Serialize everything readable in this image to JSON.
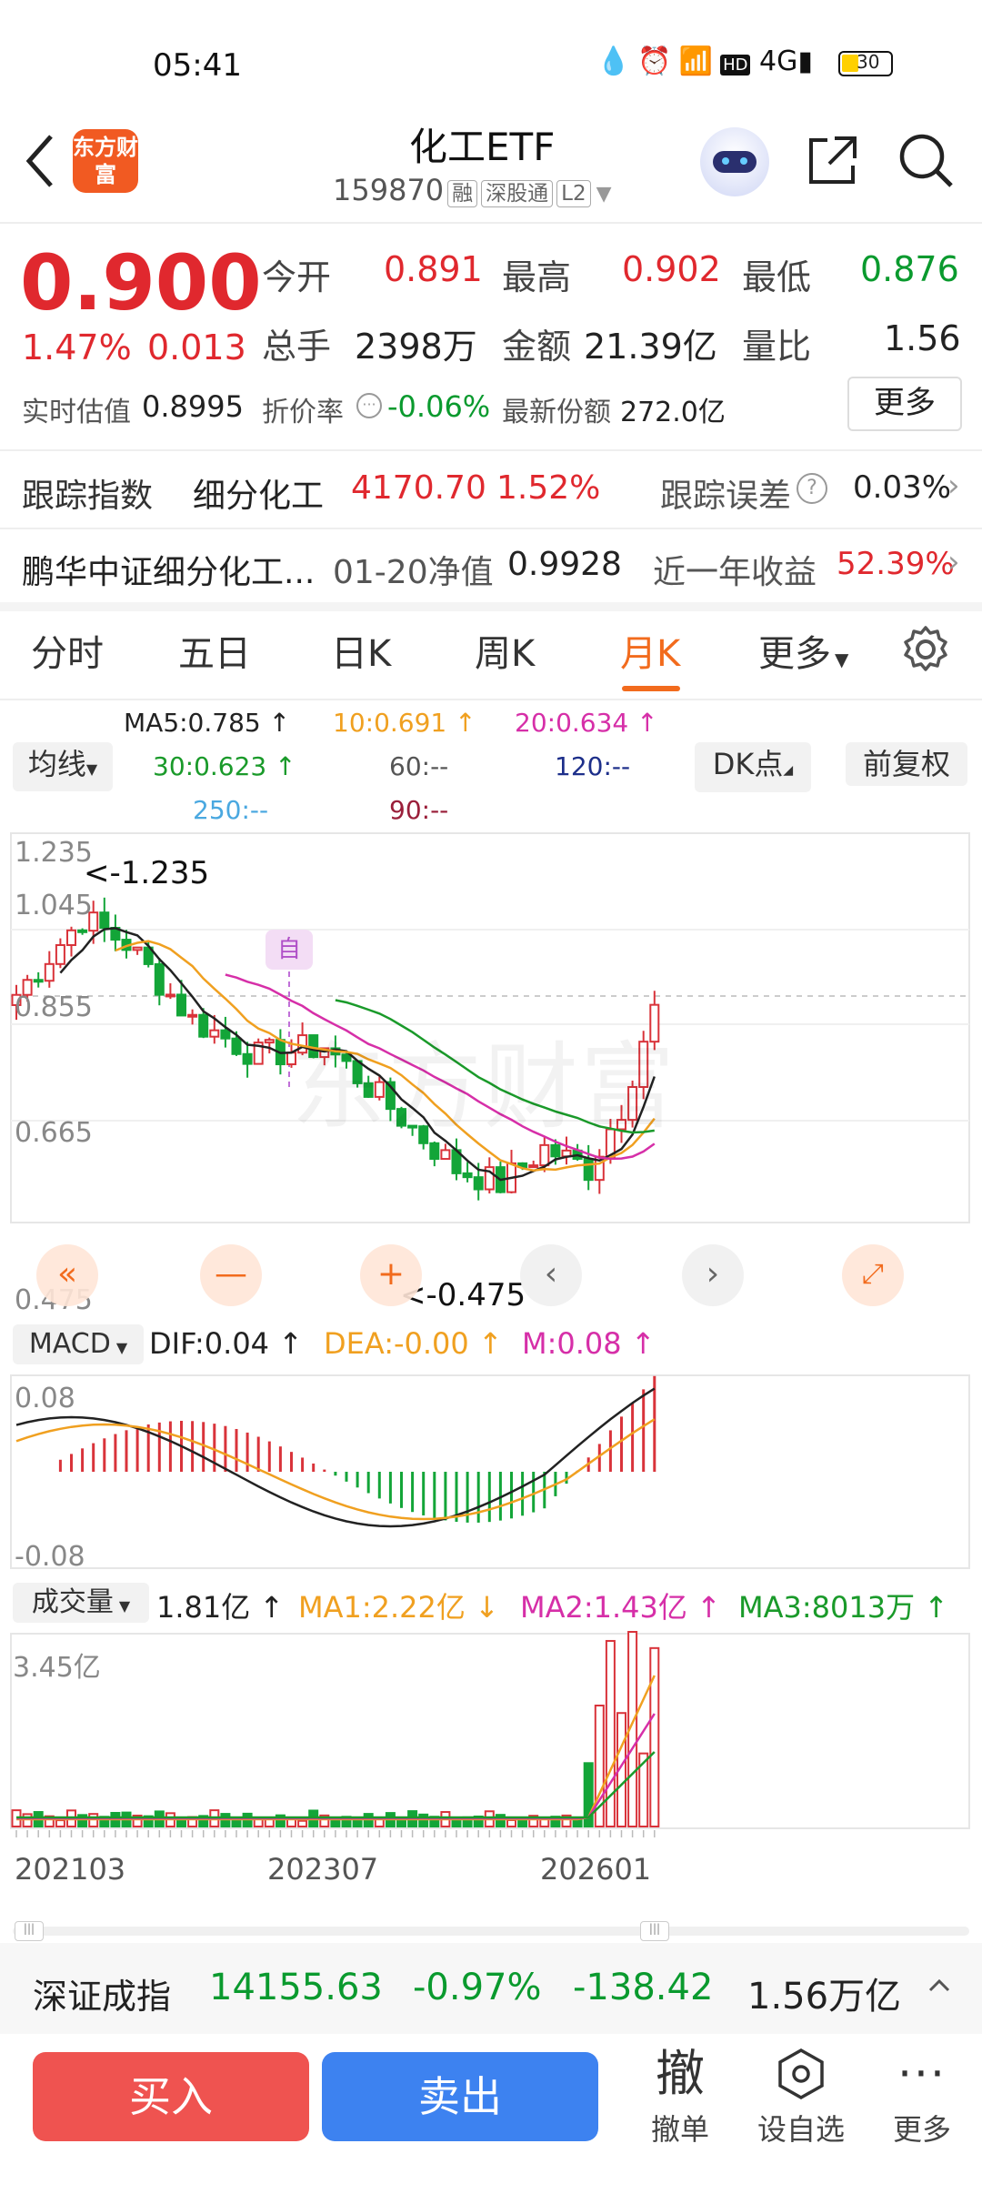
{
  "status_bar": {
    "time": "05:41",
    "battery": "30"
  },
  "header": {
    "title": "化工ETF",
    "code": "159870",
    "tags": [
      "融",
      "深股通",
      "L2"
    ],
    "logo_text": "东方财富"
  },
  "quote": {
    "price": "0.900",
    "pct": "1.47%",
    "chg": "0.013",
    "open_label": "今开",
    "open": "0.891",
    "high_label": "最高",
    "high": "0.902",
    "low_label": "最低",
    "low": "0.876",
    "vol_label": "总手",
    "vol": "2398万",
    "amt_label": "金额",
    "amt": "21.39亿",
    "ratio_label": "量比",
    "ratio": "1.56",
    "est_label": "实时估值",
    "est": "0.8995",
    "disc_label": "折价率",
    "disc": "-0.06%",
    "share_label": "最新份额",
    "share": "272.0亿",
    "more": "更多"
  },
  "tracking": {
    "label": "跟踪指数",
    "index": "细分化工",
    "value": "4170.70",
    "pct": "1.52%",
    "err_label": "跟踪误差",
    "err": "0.03%"
  },
  "fund": {
    "name": "鹏华中证细分化工...",
    "nav_label": "01-20净值",
    "nav": "0.9928",
    "ret_label": "近一年收益",
    "ret": "52.39%"
  },
  "tabs": [
    "分时",
    "五日",
    "日K",
    "周K",
    "月K",
    "更多"
  ],
  "active_tab": "月K",
  "ma_bar": {
    "selector": "均线",
    "ma5": "MA5:0.785 ↑",
    "ma10": "10:0.691 ↑",
    "ma20": "20:0.634 ↑",
    "ma30": "30:0.623 ↑",
    "ma60": "60:--",
    "ma120": "120:--",
    "ma250": "250:--",
    "ma90": "90:--",
    "dk": "DK点",
    "adj": "前复权"
  },
  "chart_data": {
    "type": "candlestick",
    "price_axis": [
      "1.235",
      "1.045",
      "0.855",
      "0.665",
      "0.475"
    ],
    "ylim": [
      0.475,
      1.235
    ],
    "max_label": "<-1.235",
    "min_label": "<-0.475",
    "marker": "自",
    "x_ticks": [
      "202103",
      "202307",
      "202601"
    ],
    "macd": {
      "selector": "MACD",
      "dif": "DIF:0.04 ↑",
      "dea": "DEA:-0.00 ↑",
      "m": "M:0.08 ↑",
      "axis_top": "0.08",
      "axis_bottom": "-0.08"
    },
    "volume": {
      "selector": "成交量",
      "vol": "1.81亿 ↑",
      "ma1": "MA1:2.22亿 ↓",
      "ma2": "MA2:1.43亿 ↑",
      "ma3": "MA3:8013万 ↑",
      "axis_top": "3.45亿"
    },
    "colors": {
      "up": "#d9333a",
      "down": "#13a538",
      "ma5": "#222222",
      "ma10": "#f0a020",
      "ma20": "#d62fa8",
      "ma30": "#1a9a2a"
    }
  },
  "index_bar": {
    "name": "深证成指",
    "value": "14155.63",
    "pct": "-0.97%",
    "chg": "-138.42",
    "amount": "1.56万亿"
  },
  "bottom": {
    "buy": "买入",
    "sell": "卖出",
    "cancel_icon_text": "撤",
    "cancel": "撤单",
    "watch": "设自选",
    "more": "更多"
  }
}
